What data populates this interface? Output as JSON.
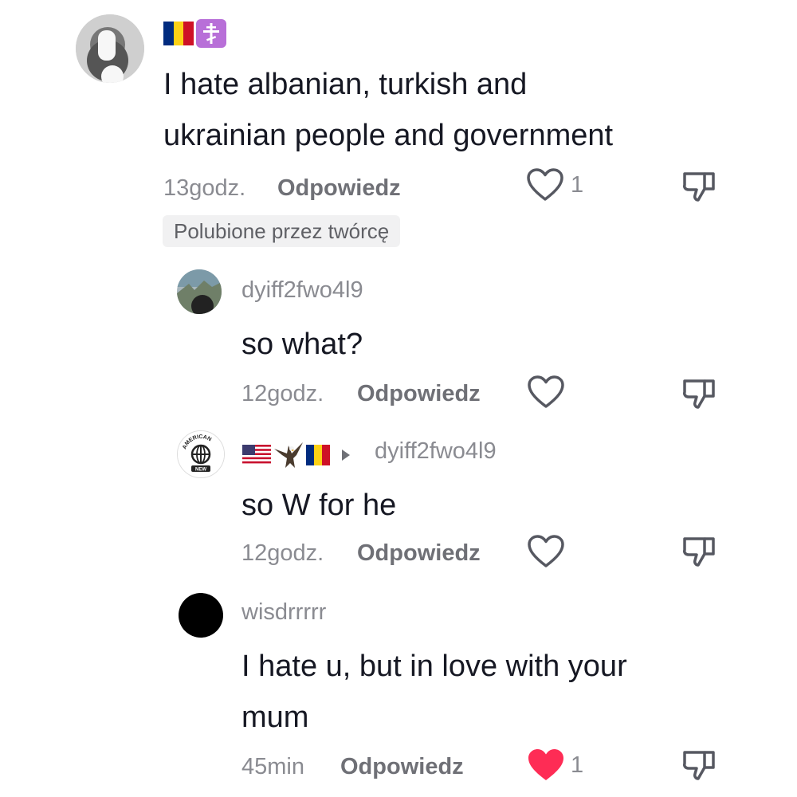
{
  "comment": {
    "text_line1": "I hate albanian, turkish and",
    "text_line2": "ukrainian people and government",
    "time": "13godz.",
    "reply_label": "Odpowiedz",
    "like_count": "1",
    "liked_by_creator": "Polubione przez twórcę"
  },
  "replies": [
    {
      "username": "dyiff2fwo4l9",
      "text": "so what?",
      "time": "12godz.",
      "reply_label": "Odpowiedz"
    },
    {
      "reply_to": "dyiff2fwo4l9",
      "text": "so W for he",
      "time": "12godz.",
      "reply_label": "Odpowiedz"
    },
    {
      "username": "wisdrrrrr",
      "text_line1": "I hate u, but in love with your",
      "text_line2": "mum",
      "time": "45min",
      "reply_label": "Odpowiedz",
      "like_count": "1"
    }
  ],
  "colors": {
    "liked_heart": "#fe2c55",
    "text": "#161823",
    "meta": "#8a8b91"
  },
  "icons": [
    "heart-outline-icon",
    "heart-filled-icon",
    "thumbs-down-icon",
    "romania-flag-icon",
    "orthodox-cross-icon",
    "usa-flag-icon",
    "eagle-icon"
  ],
  "avatar_logo": {
    "top_text": "AMERICAN",
    "bottom_text": "NEW"
  }
}
